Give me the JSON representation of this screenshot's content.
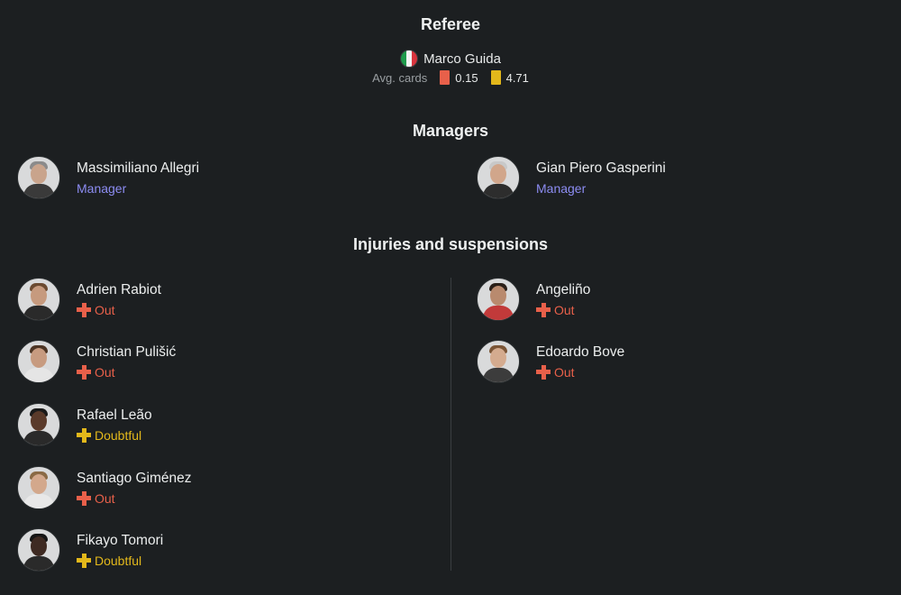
{
  "referee": {
    "title": "Referee",
    "name": "Marco Guida",
    "country_flag": "italy-flag-icon",
    "avg_cards_label": "Avg. cards",
    "red_avg": "0.15",
    "yellow_avg": "4.71"
  },
  "managers": {
    "title": "Managers",
    "home": {
      "name": "Massimiliano Allegri",
      "role": "Manager"
    },
    "away": {
      "name": "Gian Piero Gasperini",
      "role": "Manager"
    }
  },
  "injuries": {
    "title": "Injuries and suspensions",
    "home": [
      {
        "name": "Adrien Rabiot",
        "status": "Out"
      },
      {
        "name": "Christian Pulišić",
        "status": "Out"
      },
      {
        "name": "Rafael Leão",
        "status": "Doubtful"
      },
      {
        "name": "Santiago Giménez",
        "status": "Out"
      },
      {
        "name": "Fikayo Tomori",
        "status": "Doubtful"
      }
    ],
    "away": [
      {
        "name": "Angeliño",
        "status": "Out"
      },
      {
        "name": "Edoardo Bove",
        "status": "Out"
      }
    ]
  },
  "colors": {
    "background": "#1c1f21",
    "out": "#e8604a",
    "doubtful": "#e3b81b",
    "role": "#8c8cf2",
    "red_card": "#e8604a",
    "yellow_card": "#e3b81b"
  }
}
